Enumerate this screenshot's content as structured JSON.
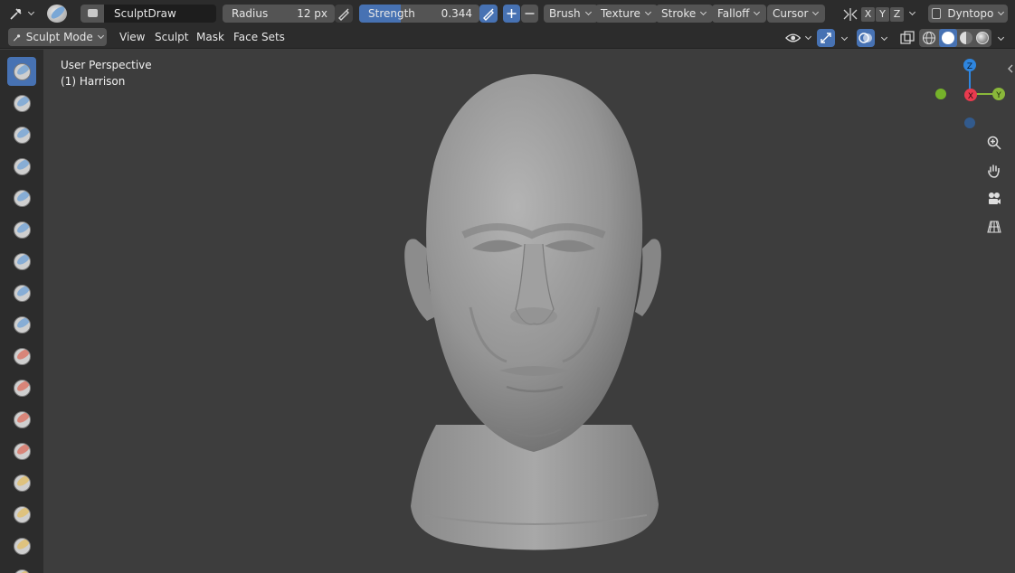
{
  "header": {
    "brush_name": "SculptDraw",
    "radius": {
      "label": "Radius",
      "value": "12 px"
    },
    "strength": {
      "label": "Strength",
      "value": "0.344",
      "fraction": 0.344
    },
    "menus": [
      "Brush",
      "Texture",
      "Stroke",
      "Falloff",
      "Cursor"
    ],
    "axes": [
      "X",
      "Y",
      "Z"
    ],
    "dyntopo": "Dyntopo"
  },
  "mode_header": {
    "mode": "Sculpt Mode",
    "menus": [
      "View",
      "Sculpt",
      "Mask",
      "Face Sets"
    ]
  },
  "viewport": {
    "view_name": "User Perspective",
    "object_name": "(1) Harrison"
  },
  "gizmo": {
    "z_label": "Z",
    "x_label": "X",
    "y_label": "Y"
  },
  "colors": {
    "accent": "#4772b3",
    "axis_x": "#e83a4e",
    "axis_y": "#8ab83a",
    "axis_z": "#2e86e0"
  },
  "tools": [
    "draw-icon",
    "draw-sharp-icon",
    "clay-icon",
    "clay-strips-icon",
    "layer-icon",
    "inflate-icon",
    "blob-icon",
    "crease-icon",
    "smooth-icon",
    "flatten-icon",
    "fill-icon",
    "scrape-icon",
    "multiplane-scrape-icon",
    "pinch-icon",
    "grab-icon",
    "snake-hook-icon",
    "thumb-icon"
  ]
}
